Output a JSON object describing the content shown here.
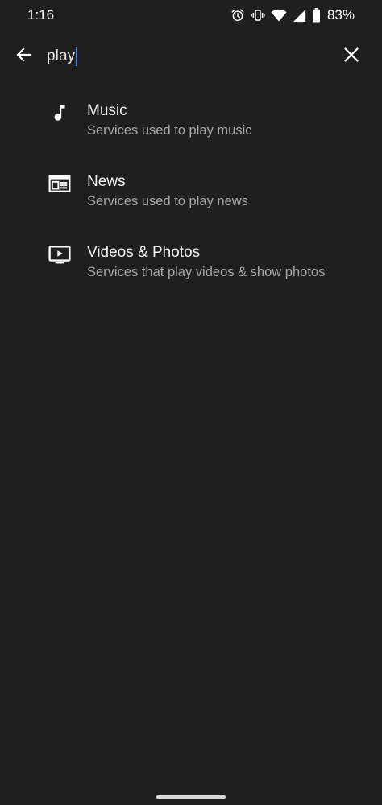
{
  "status_bar": {
    "time": "1:16",
    "battery_percent": "83%",
    "icons": [
      "alarm-icon",
      "vibrate-icon",
      "wifi-icon",
      "signal-icon",
      "battery-icon"
    ]
  },
  "search": {
    "query": "play",
    "back_icon": "arrow-back-icon",
    "clear_icon": "close-icon",
    "caret_color": "#5b7fe0"
  },
  "results": [
    {
      "icon": "music-note-icon",
      "title": "Music",
      "subtitle": "Services used to play music"
    },
    {
      "icon": "news-icon",
      "title": "News",
      "subtitle": "Services used to play news"
    },
    {
      "icon": "tv-play-icon",
      "title": "Videos & Photos",
      "subtitle": "Services that play videos & show photos"
    }
  ],
  "colors": {
    "background": "#1f1f1f",
    "title_text": "#f1f1f1",
    "subtitle_text": "#a8a8a8"
  }
}
